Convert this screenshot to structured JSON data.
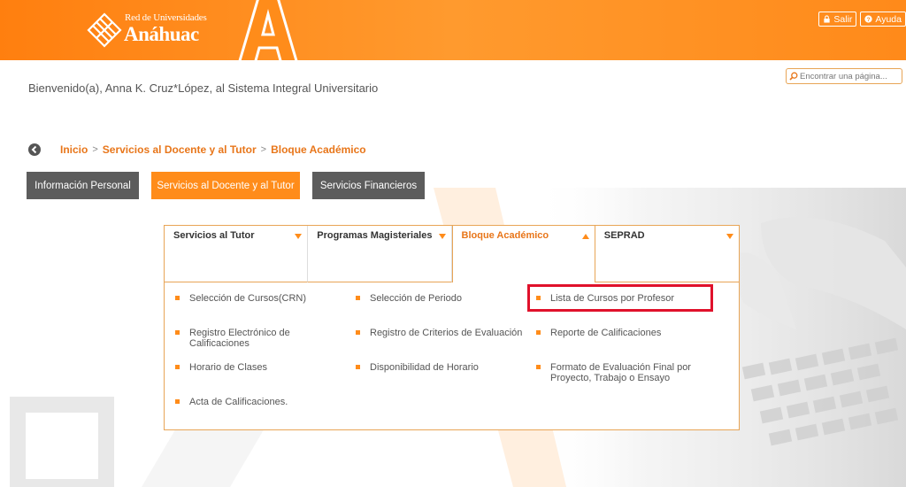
{
  "header": {
    "logo_sub": "Red de Universidades",
    "logo_main": "Anáhuac",
    "salir_label": "Salir",
    "ayuda_label": "Ayuda"
  },
  "search": {
    "placeholder": "Encontrar una página..."
  },
  "welcome": "Bienvenido(a), Anna K. Cruz*López, al Sistema Integral Universitario",
  "breadcrumb": {
    "items": [
      "Inicio",
      "Servicios al Docente y al Tutor",
      "Bloque Académico"
    ],
    "separator": ">"
  },
  "main_nav": [
    {
      "label": "Información Personal"
    },
    {
      "label": "Servicios al Docente y al Tutor"
    },
    {
      "label": "Servicios Financieros"
    }
  ],
  "tabs": [
    {
      "label": "Servicios al Tutor"
    },
    {
      "label": "Programas Magisteriales"
    },
    {
      "label": "Bloque Académico"
    },
    {
      "label": "SEPRAD"
    }
  ],
  "menu_items": [
    {
      "label": "Selección de Cursos(CRN)"
    },
    {
      "label": "Selección de Periodo"
    },
    {
      "label": "Lista de Cursos por Profesor"
    },
    {
      "label": "Registro Electrónico de Calificaciones"
    },
    {
      "label": "Registro de Criterios de Evaluación"
    },
    {
      "label": "Reporte de Calificaciones"
    },
    {
      "label": "Horario de Clases"
    },
    {
      "label": "Disponibilidad de Horario"
    },
    {
      "label": "Formato de Evaluación Final por Proyecto, Trabajo o Ensayo"
    },
    {
      "label": "Acta de Calificaciones."
    }
  ],
  "colors": {
    "brand_orange": "#ff8c1a",
    "highlight_red": "#e0112b",
    "nav_gray": "#5c5c5c"
  }
}
